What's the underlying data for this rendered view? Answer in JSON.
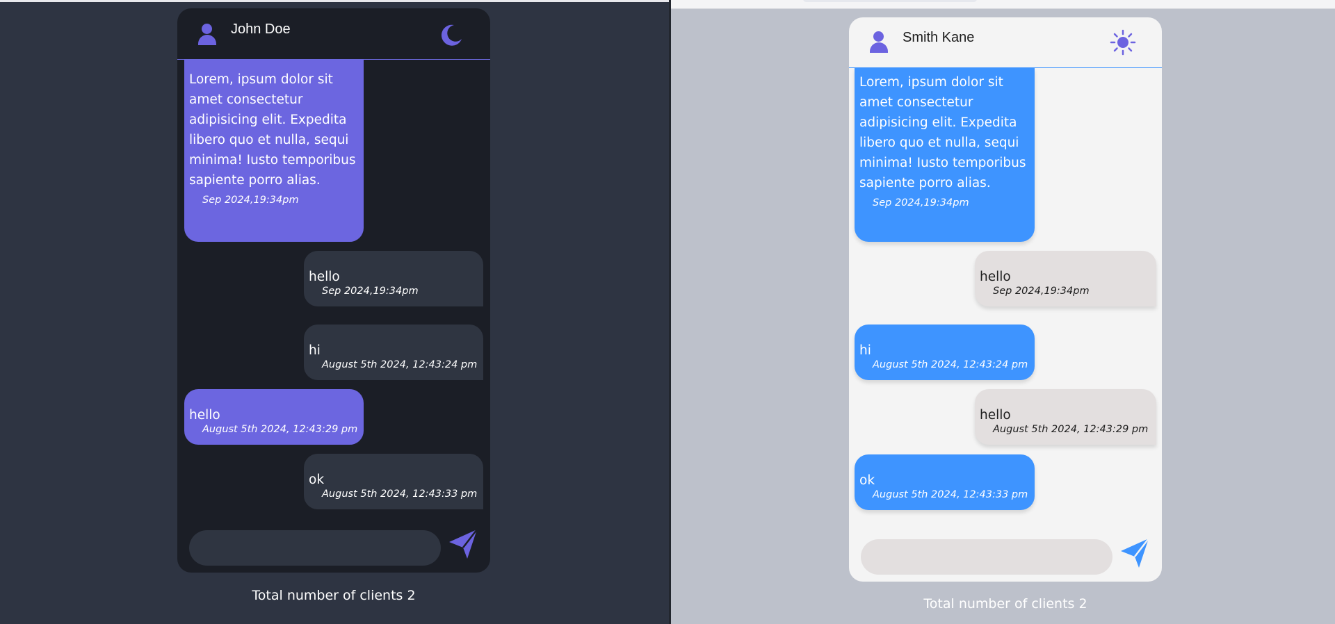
{
  "colors": {
    "dark_bg": "#2e3442",
    "dark_card": "#1b1e26",
    "dark_incoming": "#6c66e0",
    "dark_outgoing": "#2f3541",
    "light_bg": "#bdc1cb",
    "light_card": "#f4f4f4",
    "light_incoming": "#3e94ff",
    "light_outgoing": "#e3dfdf",
    "accent_purple": "#6c63e0",
    "accent_blue": "#3e94ff"
  },
  "left": {
    "user_name": "John Doe",
    "theme_icon": "moon-icon",
    "messages": [
      {
        "direction": "in",
        "text": "Lorem, ipsum dolor sit amet consectetur adipisicing elit. Expedita libero quo et nulla, sequi minima! Iusto temporibus sapiente porro alias.",
        "time": "Sep 2024,19:34pm"
      },
      {
        "direction": "out",
        "text": "hello",
        "time": "Sep 2024,19:34pm"
      },
      {
        "direction": "out",
        "text": "hi",
        "time": "August 5th 2024, 12:43:24 pm"
      },
      {
        "direction": "in",
        "text": "hello",
        "time": "August 5th 2024, 12:43:29 pm"
      },
      {
        "direction": "out",
        "text": "ok",
        "time": "August 5th 2024, 12:43:33 pm"
      }
    ],
    "input_value": "",
    "client_count": "Total number of clients 2"
  },
  "right": {
    "user_name": "Smith Kane",
    "theme_icon": "sun-icon",
    "messages": [
      {
        "direction": "in",
        "text": "Lorem, ipsum dolor sit amet consectetur adipisicing elit. Expedita libero quo et nulla, sequi minima! Iusto temporibus sapiente porro alias.",
        "time": "Sep 2024,19:34pm"
      },
      {
        "direction": "out",
        "text": "hello",
        "time": "Sep 2024,19:34pm"
      },
      {
        "direction": "in",
        "text": "hi",
        "time": "August 5th 2024, 12:43:24 pm"
      },
      {
        "direction": "out",
        "text": "hello",
        "time": "August 5th 2024, 12:43:29 pm"
      },
      {
        "direction": "in",
        "text": "ok",
        "time": "August 5th 2024, 12:43:33 pm"
      }
    ],
    "input_value": "",
    "client_count": "Total number of clients 2"
  }
}
